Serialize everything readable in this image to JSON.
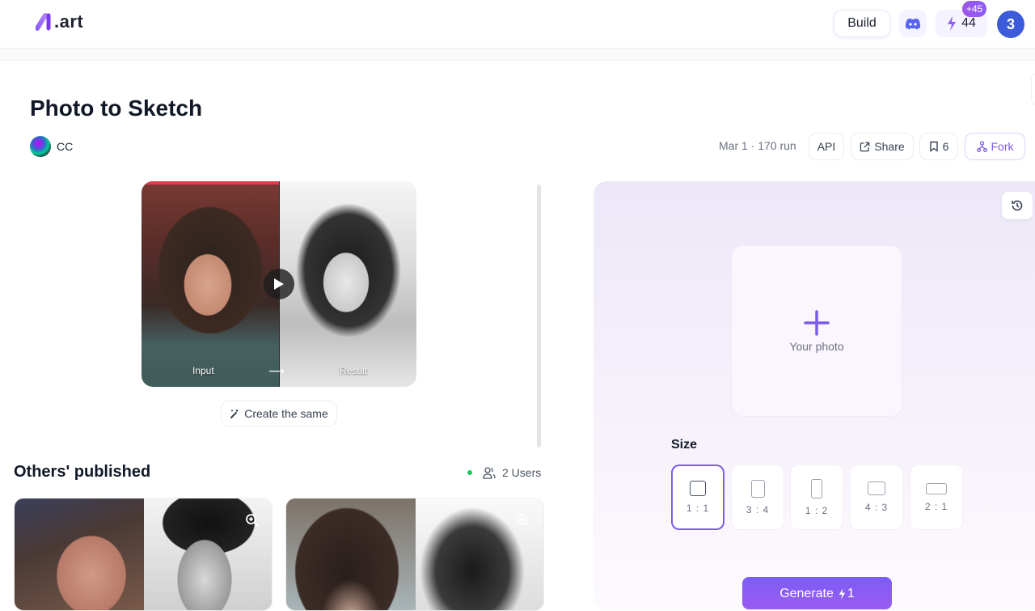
{
  "header": {
    "logo_text": ".art",
    "build_label": "Build",
    "credits": "44",
    "credits_bonus": "+45",
    "user_initial": "3"
  },
  "page": {
    "title": "Photo to Sketch",
    "author": "CC",
    "meta": "Mar 1 · 170 run",
    "actions": {
      "api": "API",
      "share": "Share",
      "saves": "6",
      "fork": "Fork"
    }
  },
  "preview": {
    "input_label": "Input",
    "arrow": "⟶",
    "result_label": "Result",
    "create_same_label": "Create the same"
  },
  "others": {
    "title": "Others' published",
    "users": "2 Users"
  },
  "generator": {
    "upload_label": "Your photo",
    "size_label": "Size",
    "sizes": [
      "1 : 1",
      "3 : 4",
      "1 : 2",
      "4 : 3",
      "2 : 1"
    ],
    "selected_size": "1 : 1",
    "generate_label": "Generate",
    "generate_cost": "1"
  },
  "colors": {
    "accent": "#7c5ce6",
    "user_avatar": "#3b5bdb",
    "online": "#22c55e"
  }
}
